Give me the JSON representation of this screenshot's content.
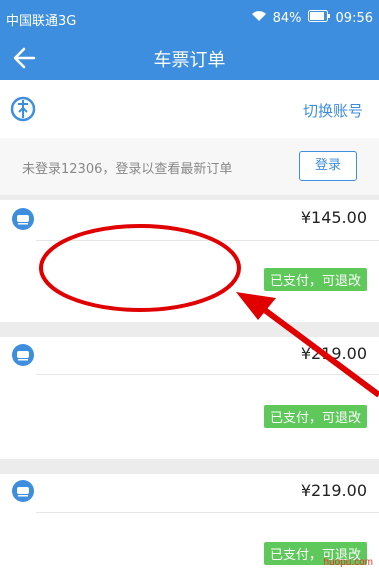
{
  "status": {
    "carrier": "中国联通3G",
    "battery": "84%",
    "time": "09:56"
  },
  "appbar": {
    "title": "车票订单",
    "back_icon": "arrow-left-icon"
  },
  "account": {
    "switch_label": "切换账号",
    "logo_icon": "railway-logo-icon"
  },
  "login": {
    "message": "未登录12306，登录以查看最新订单",
    "button": "登录"
  },
  "orders": [
    {
      "price": "¥145.00",
      "status": "已支付，可退改"
    },
    {
      "price": "¥219.00",
      "status": "已支付，可退改"
    },
    {
      "price": "¥219.00",
      "status": "已支付，可退改"
    }
  ],
  "watermark": "huopu.com",
  "colors": {
    "primary": "#3e8ee0",
    "badge": "#5ec85a",
    "annotation": "#e00000"
  }
}
